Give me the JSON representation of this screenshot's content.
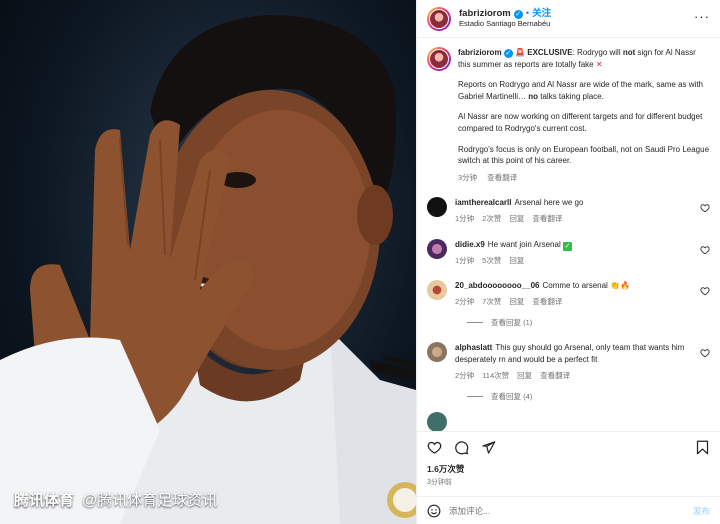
{
  "watermark": {
    "brand": "腾讯体育",
    "handle": "@腾讯体育足球资讯"
  },
  "header": {
    "username": "fabriziorom",
    "separator": "•",
    "follow_label": "关注",
    "location": "Estadio Santiago Bernabéu",
    "more_icon": "more-dots-icon"
  },
  "caption": {
    "username": "fabriziorom",
    "intro_bold": "EXCLUSIVE",
    "line1_a": ": Rodrygo will ",
    "line1_not": "not",
    "line1_b": " sign for Al Nassr this summer as reports are totally fake",
    "p2_a": "Reports on Rodrygo and Al Nassr are wide of the mark, same as with Gabriel Martinelli… ",
    "p2_no": "no",
    "p2_b": " talks taking place.",
    "p3": "Al Nassr are now working on different targets and for different budget compared to Rodrygo's current cost.",
    "p4": "Rodrygo's focus is only on European football, not on Saudi Pro League switch at this point of his career.",
    "time": "3分钟",
    "translate": "查看翻译"
  },
  "comments": [
    {
      "user": "iamtherealcarll",
      "text": "Arsenal here we go",
      "time": "1分钟",
      "likes": "2次赞",
      "reply": "回复",
      "translate": "查看翻译",
      "avatar_color": "#111111"
    },
    {
      "user": "didie.x9",
      "text": "He want join Arsenal",
      "time": "1分钟",
      "likes": "5次赞",
      "reply": "回复",
      "avatar_color": "#4a2b5e"
    },
    {
      "user": "20_abdoooooooo__06",
      "text": "Comme to arsenal",
      "time": "2分钟",
      "likes": "7次赞",
      "reply": "回复",
      "translate": "查看翻译",
      "view_replies": "查看回复 (1)",
      "avatar_color": "#e7c9a0"
    },
    {
      "user": "alphaslatt",
      "text": "This guy should go Arsenal, only team that wants him desperately rn and would be a perfect fit",
      "time": "2分钟",
      "likes": "114次赞",
      "reply": "回复",
      "translate": "查看翻译",
      "view_replies": "查看回复 (4)",
      "avatar_color": "#8a7560"
    }
  ],
  "actions": {
    "likes": "1.6万次赞",
    "time_ago": "3分钟前"
  },
  "add_comment": {
    "placeholder": "添加评论...",
    "post_label": "发布"
  },
  "colors": {
    "accent": "#0095f6",
    "text": "#262626",
    "muted": "#737373"
  }
}
